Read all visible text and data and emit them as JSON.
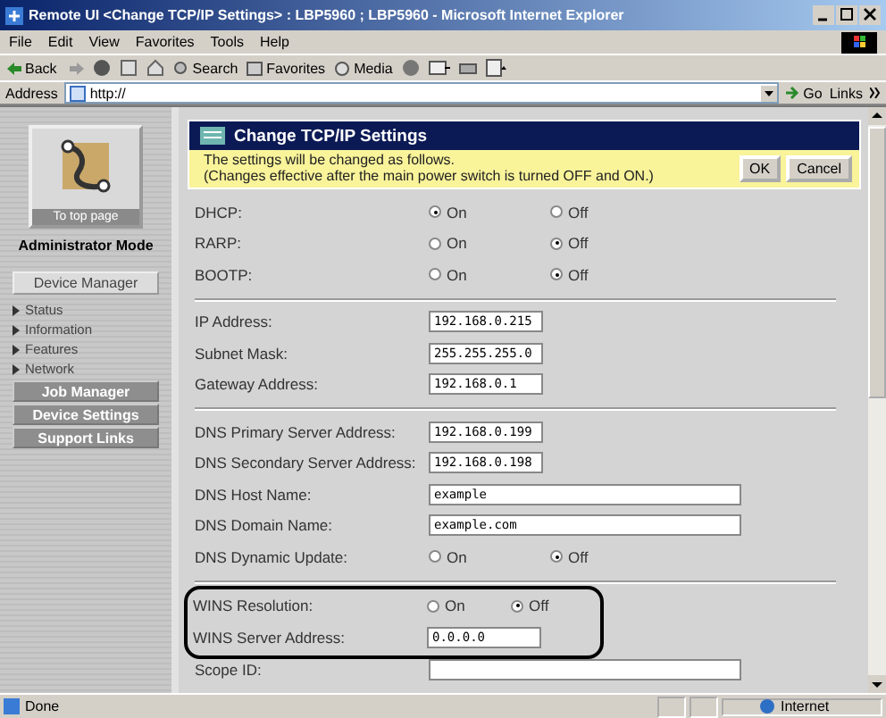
{
  "window": {
    "title": "Remote UI <Change TCP/IP Settings> : LBP5960 ; LBP5960 - Microsoft Internet Explorer"
  },
  "menu": [
    "File",
    "Edit",
    "View",
    "Favorites",
    "Tools",
    "Help"
  ],
  "toolbar": {
    "back": "Back",
    "search": "Search",
    "favorites": "Favorites",
    "media": "Media"
  },
  "address": {
    "label": "Address",
    "value": "http://",
    "go": "Go",
    "links": "Links"
  },
  "sidebar": {
    "top_link": "To top page",
    "mode": "Administrator Mode",
    "device_manager": "Device Manager",
    "items": [
      "Status",
      "Information",
      "Features",
      "Network"
    ],
    "buttons": [
      "Job Manager",
      "Device Settings",
      "Support Links"
    ]
  },
  "panel": {
    "title": "Change TCP/IP Settings",
    "notice": [
      "The settings will be changed as follows.",
      "(Changes effective after the main power switch is turned OFF and ON.)"
    ],
    "ok": "OK",
    "cancel": "Cancel",
    "sections": [
      {
        "groups": [
          {
            "highlighted": false,
            "rows": [
              {
                "kind": "radio",
                "label": "DHCP:",
                "options": [
                  {
                    "label": "On",
                    "selected": true
                  },
                  {
                    "label": "Off",
                    "selected": false
                  }
                ]
              },
              {
                "kind": "radio",
                "label": "RARP:",
                "options": [
                  {
                    "label": "On",
                    "selected": false
                  },
                  {
                    "label": "Off",
                    "selected": true
                  }
                ]
              },
              {
                "kind": "radio",
                "label": "BOOTP:",
                "options": [
                  {
                    "label": "On",
                    "selected": false
                  },
                  {
                    "label": "Off",
                    "selected": true
                  }
                ]
              }
            ]
          }
        ]
      },
      {
        "groups": [
          {
            "highlighted": false,
            "rows": [
              {
                "kind": "input",
                "label": "IP Address:",
                "value": "192.168.0.215",
                "wide": false
              },
              {
                "kind": "input",
                "label": "Subnet Mask:",
                "value": "255.255.255.0",
                "wide": false
              },
              {
                "kind": "input",
                "label": "Gateway Address:",
                "value": "192.168.0.1",
                "wide": false
              }
            ]
          }
        ]
      },
      {
        "groups": [
          {
            "highlighted": false,
            "rows": [
              {
                "kind": "input",
                "label": "DNS Primary Server Address:",
                "value": "192.168.0.199",
                "wide": false
              },
              {
                "kind": "input",
                "label": "DNS Secondary Server Address:",
                "value": "192.168.0.198",
                "wide": false
              },
              {
                "kind": "input",
                "label": "DNS Host Name:",
                "value": "example",
                "wide": true
              },
              {
                "kind": "input",
                "label": "DNS Domain Name:",
                "value": "example.com",
                "wide": true
              },
              {
                "kind": "radio",
                "label": "DNS Dynamic Update:",
                "options": [
                  {
                    "label": "On",
                    "selected": false
                  },
                  {
                    "label": "Off",
                    "selected": true
                  }
                ]
              }
            ]
          }
        ]
      },
      {
        "groups": [
          {
            "highlighted": true,
            "rows": [
              {
                "kind": "radio",
                "label": "WINS Resolution:",
                "options": [
                  {
                    "label": "On",
                    "selected": false
                  },
                  {
                    "label": "Off",
                    "selected": true
                  }
                ]
              },
              {
                "kind": "input",
                "label": "WINS Server Address:",
                "value": "0.0.0.0",
                "wide": false
              }
            ]
          },
          {
            "highlighted": false,
            "rows": [
              {
                "kind": "input",
                "label": "Scope ID:",
                "value": "",
                "wide": true
              }
            ]
          }
        ]
      }
    ]
  },
  "status_bar": {
    "text": "Done",
    "zone": "Internet"
  }
}
